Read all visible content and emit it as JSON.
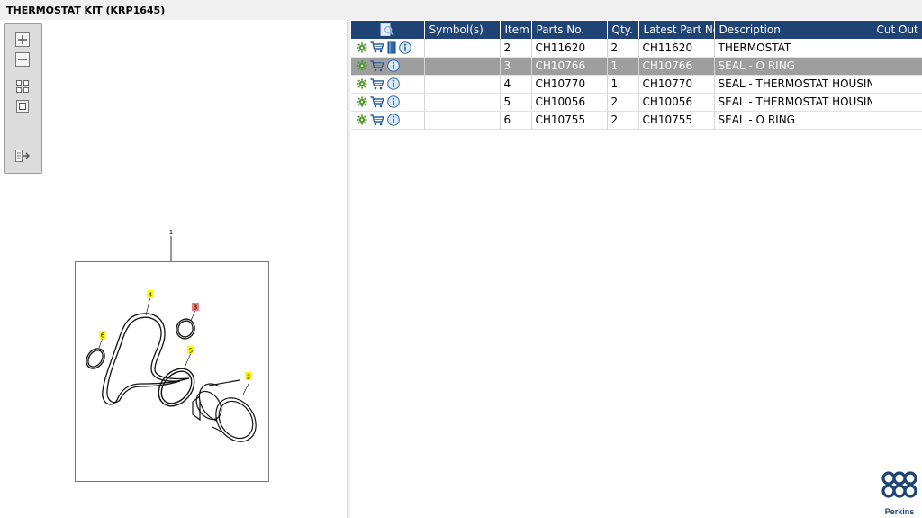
{
  "window": {
    "title": "THERMOSTAT KIT (KRP1645)"
  },
  "toolbar": {
    "buttons": [
      {
        "icon": "zoom-in-icon"
      },
      {
        "icon": "zoom-out-icon"
      },
      {
        "icon": "fit-all-icon"
      },
      {
        "icon": "actual-size-icon"
      },
      {
        "icon": "export-list-icon"
      }
    ]
  },
  "diagram": {
    "callouts": [
      {
        "label": "1",
        "highlight": "none"
      },
      {
        "label": "4",
        "highlight": "#ffff00"
      },
      {
        "label": "3",
        "highlight": "#e88080"
      },
      {
        "label": "6",
        "highlight": "#ffff00"
      },
      {
        "label": "5",
        "highlight": "#ffff00"
      },
      {
        "label": "2",
        "highlight": "#ffff00"
      }
    ]
  },
  "table": {
    "columns": [
      "",
      "Symbol(s)",
      "Item",
      "Parts No.",
      "Qty.",
      "Latest Part No.",
      "Description",
      "Cut Out"
    ],
    "rows": [
      {
        "symbols": "",
        "item": "2",
        "part_no": "CH11620",
        "qty": "2",
        "latest_part_no": "CH11620",
        "description": "THERMOSTAT",
        "cut_out": "",
        "selected": false,
        "has_book": true
      },
      {
        "symbols": "",
        "item": "3",
        "part_no": "CH10766",
        "qty": "1",
        "latest_part_no": "CH10766",
        "description": "SEAL - O RING",
        "cut_out": "",
        "selected": true,
        "has_book": false
      },
      {
        "symbols": "",
        "item": "4",
        "part_no": "CH10770",
        "qty": "1",
        "latest_part_no": "CH10770",
        "description": "SEAL - THERMOSTAT HOUSING",
        "cut_out": "",
        "selected": false,
        "has_book": false
      },
      {
        "symbols": "",
        "item": "5",
        "part_no": "CH10056",
        "qty": "2",
        "latest_part_no": "CH10056",
        "description": "SEAL - THERMOSTAT HOUSING",
        "cut_out": "",
        "selected": false,
        "has_book": false
      },
      {
        "symbols": "",
        "item": "6",
        "part_no": "CH10755",
        "qty": "2",
        "latest_part_no": "CH10755",
        "description": "SEAL - O RING",
        "cut_out": "",
        "selected": false,
        "has_book": false
      }
    ]
  },
  "branding": {
    "wordmark": "Perkins"
  },
  "colors": {
    "header_bg": "#1e4374",
    "selected_row": "#9e9e9e",
    "gear": "#4a9a2a",
    "cart": "#2a5a9a",
    "info": "#2a6ab0"
  }
}
